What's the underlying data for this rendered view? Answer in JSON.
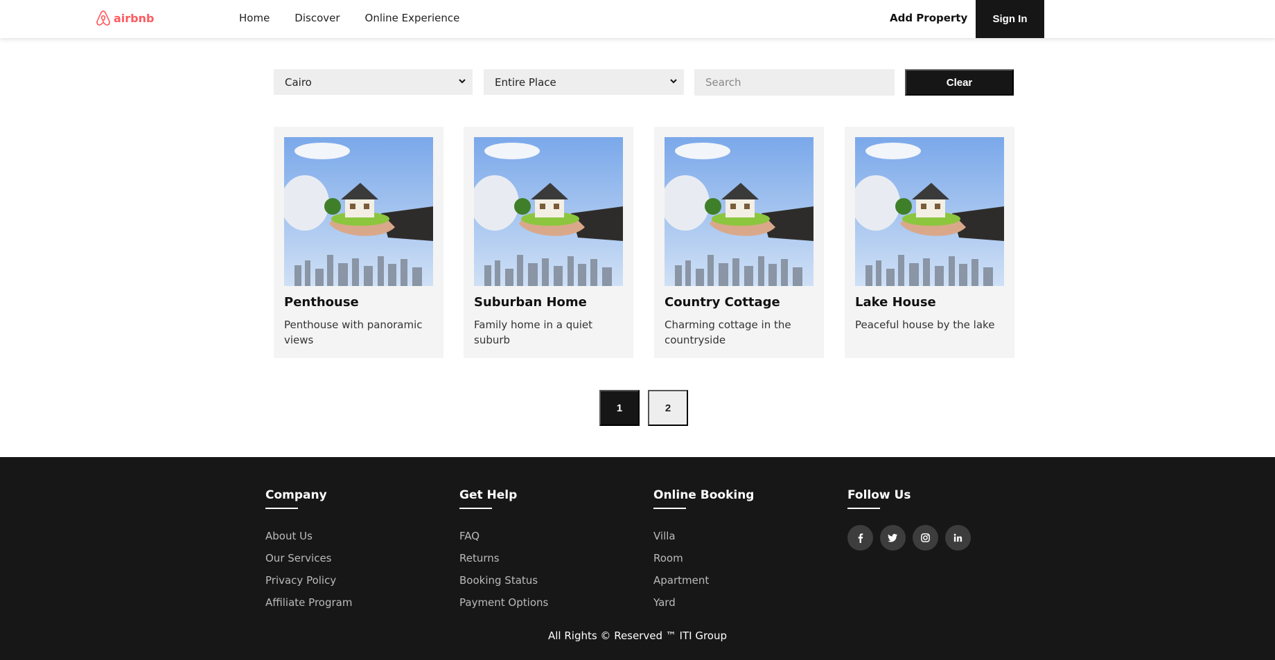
{
  "header": {
    "logo_text": "airbnb",
    "nav": [
      "Home",
      "Discover",
      "Online Experience"
    ],
    "add_property": "Add Property",
    "sign_in": "Sign In"
  },
  "filters": {
    "city": "Cairo",
    "type": "Entire Place",
    "search_placeholder": "Search",
    "clear": "Clear"
  },
  "cards": [
    {
      "title": "Penthouse",
      "desc": "Penthouse with panoramic views"
    },
    {
      "title": "Suburban Home",
      "desc": "Family home in a quiet suburb"
    },
    {
      "title": "Country Cottage",
      "desc": "Charming cottage in the countryside"
    },
    {
      "title": "Lake House",
      "desc": "Peaceful house by the lake"
    }
  ],
  "pagination": {
    "pages": [
      "1",
      "2"
    ],
    "active": "1"
  },
  "footer": {
    "columns": [
      {
        "title": "Company",
        "items": [
          "About Us",
          "Our Services",
          "Privacy Policy",
          "Affiliate Program"
        ]
      },
      {
        "title": "Get Help",
        "items": [
          "FAQ",
          "Returns",
          "Booking Status",
          "Payment Options"
        ]
      },
      {
        "title": "Online Booking",
        "items": [
          "Villa",
          "Room",
          "Apartment",
          "Yard"
        ]
      },
      {
        "title": "Follow Us",
        "socials": [
          "facebook-icon",
          "twitter-icon",
          "instagram-icon",
          "linkedin-icon"
        ]
      }
    ],
    "copyright": "All Rights © Reserved ™ ITI Group"
  },
  "colors": {
    "brand": "#ff5a5f",
    "dark": "#161616"
  }
}
